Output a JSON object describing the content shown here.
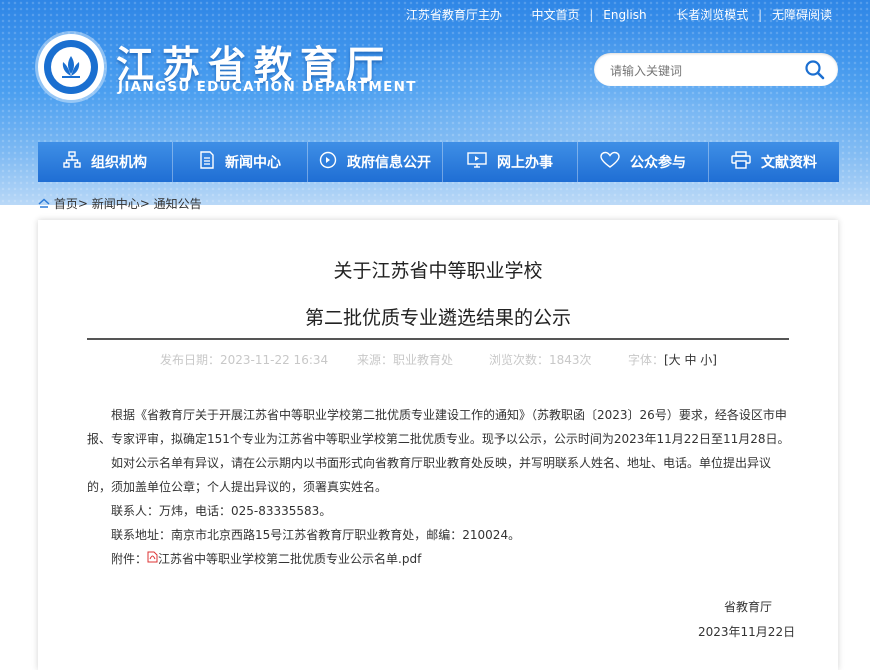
{
  "header": {
    "top_links": [
      "江苏省教育厅主办",
      "中文首页",
      "English",
      "长者浏览模式",
      "无障碍阅读"
    ],
    "title": "江苏省教育厅",
    "subtitle": "JIANGSU EDUCATION DEPARTMENT",
    "search_placeholder": "请输入关键词",
    "search_icon": "search-icon"
  },
  "nav": [
    {
      "label": "组织机构",
      "icon": "org-chart-icon"
    },
    {
      "label": "新闻中心",
      "icon": "document-icon"
    },
    {
      "label": "政府信息公开",
      "icon": "info-circle-icon"
    },
    {
      "label": "网上办事",
      "icon": "monitor-icon"
    },
    {
      "label": "公众参与",
      "icon": "heart-icon"
    },
    {
      "label": "文献资料",
      "icon": "printer-icon"
    }
  ],
  "breadcrumb": {
    "home": "首页",
    "sep": ">",
    "news": "新闻中心",
    "current": "通知公告"
  },
  "article": {
    "title_line1": "关于江苏省中等职业学校",
    "title_line2": "第二批优质专业遴选结果的公示",
    "meta": {
      "date": "发布日期：2023-11-22 16:34",
      "source": "来源：职业教育处",
      "views": "浏览次数：1843次",
      "fontsize_label": "字体：",
      "fontsize_options": "[大 中 小]"
    },
    "paragraphs": [
      "根据《省教育厅关于开展江苏省中等职业学校第二批优质专业建设工作的通知》（苏教职函〔2023〕26号）要求，经各设区市申报、专家评审，拟确定151个专业为江苏省中等职业学校第二批优质专业。现予以公示，公示时间为2023年11月22日至11月28日。",
      "如对公示名单有异议，请在公示期内以书面形式向省教育厅职业教育处反映，并写明联系人姓名、地址、电话。单位提出异议的，须加盖单位公章；个人提出异议的，须署真实姓名。",
      "联系人：万炜，电话：025-83335583。",
      "联系地址：南京市北京西路15号江苏省教育厅职业教育处，邮编：210024。"
    ],
    "attachment_label": "附件：",
    "attachment_file": "江苏省中等职业学校第二批优质专业公示名单.pdf",
    "signature_org": "省教育厅",
    "signature_date": "2023年11月22日"
  },
  "colors": {
    "nav": "#1f6ed4",
    "header_top": "#2f86e6"
  }
}
